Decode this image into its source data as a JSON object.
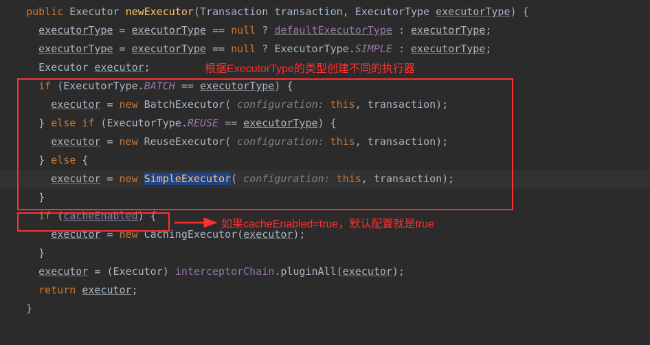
{
  "code": {
    "l1_public": "public",
    "l1_ret": "Executor",
    "l1_method": "newExecutor",
    "l1_p1type": "Transaction",
    "l1_p1name": "transaction",
    "l1_p2type": "ExecutorType",
    "l1_p2name": "executorType",
    "l2_lhs": "executorType",
    "l2_rhs1": "executorType",
    "l2_eq": "==",
    "l2_null": "null",
    "l2_q": "?",
    "l2_default": "defaultExecutorType",
    "l2_colon": ":",
    "l2_rhs2": "executorType",
    "l3_lhs": "executorType",
    "l3_rhs1": "executorType",
    "l3_eq": "==",
    "l3_null": "null",
    "l3_q": "?",
    "l3_type": "ExecutorType",
    "l3_simple": "SIMPLE",
    "l3_colon": ":",
    "l3_rhs2": "executorType",
    "l4_type": "Executor",
    "l4_var": "executor",
    "l5_if": "if",
    "l5_type": "ExecutorType",
    "l5_batch": "BATCH",
    "l5_eq": "==",
    "l5_var": "executorType",
    "l6_lhs": "executor",
    "l6_new": "new",
    "l6_class": "BatchExecutor",
    "l6_hint": "configuration:",
    "l6_this": "this",
    "l6_arg": "transaction",
    "l7_else": "else if",
    "l7_type": "ExecutorType",
    "l7_reuse": "REUSE",
    "l7_eq": "==",
    "l7_var": "executorType",
    "l8_lhs": "executor",
    "l8_new": "new",
    "l8_class": "ReuseExecutor",
    "l8_hint": "configuration:",
    "l8_this": "this",
    "l8_arg": "transaction",
    "l9_else": "else",
    "l10_lhs": "executor",
    "l10_new": "new",
    "l10_class": "SimpleExecutor",
    "l10_hint": "configuration:",
    "l10_this": "this",
    "l10_arg": "transaction",
    "l12_if": "if",
    "l12_var": "cacheEnabled",
    "l13_lhs": "executor",
    "l13_new": "new",
    "l13_class": "CachingExecutor",
    "l13_arg": "executor",
    "l15_lhs": "executor",
    "l15_cast": "Executor",
    "l15_chain": "interceptorChain",
    "l15_method": "pluginAll",
    "l15_arg": "executor",
    "l16_return": "return",
    "l16_var": "executor"
  },
  "annotations": {
    "top": "根据ExecutorType的类型创建不同的执行器",
    "bottom": "如果cacheEnabled=true，默认配置就是true"
  }
}
